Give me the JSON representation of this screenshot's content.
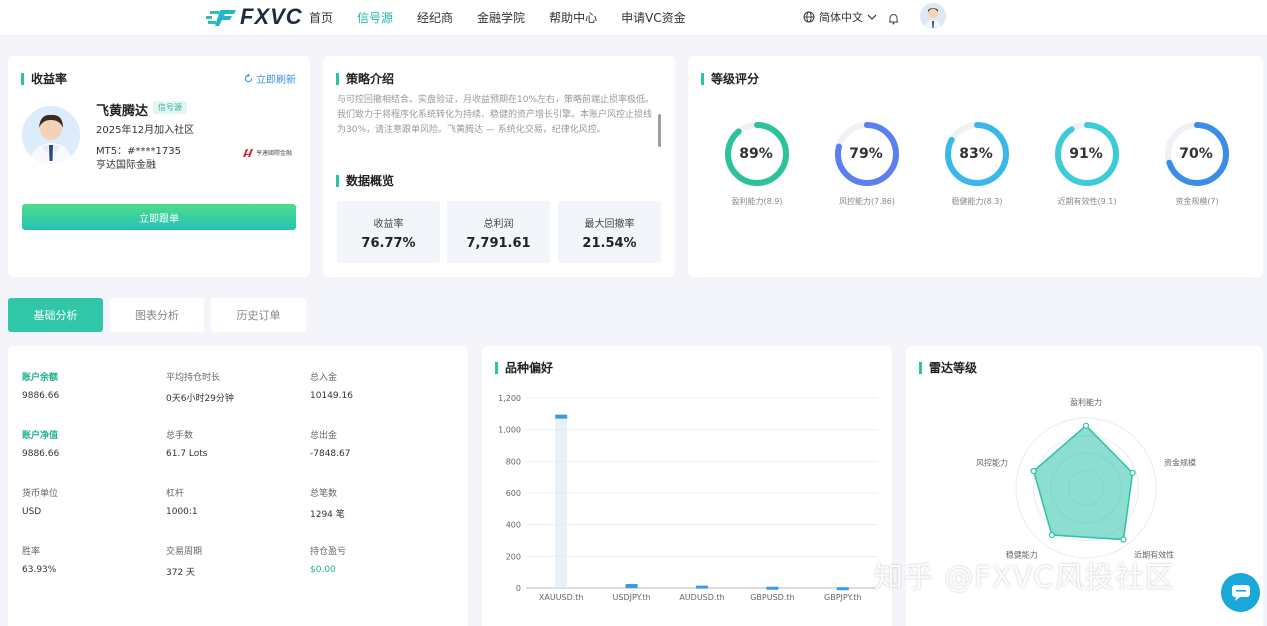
{
  "header": {
    "logo": "FXVC",
    "nav": [
      "首页",
      "信号源",
      "经纪商",
      "金融学院",
      "帮助中心",
      "申请VC资金"
    ],
    "active_index": 1,
    "language": "简体中文",
    "accent": "#1fb8a6"
  },
  "profile": {
    "title": "收益率",
    "refresh": "立即刷新",
    "name": "飞黄腾达",
    "badge": "信号源",
    "joined": "2025年12月加入社区",
    "mt5": "MT5：#****1735",
    "broker": "亨达国际金融",
    "broker_logo_text": "亨達國際金融",
    "follow": "立即跟单"
  },
  "strategy": {
    "title": "策略介绍",
    "text": "与可控回撤相结合。实盘验证，月收益预期在10%左右，策略前端止损率极低。我们致力于将程序化系统转化为持续、稳健的资产增长引擎。本账户风控止损线为30%，请注意跟单风险。飞黄腾达 — 系统化交易，纪律化风控。",
    "overview_title": "数据概览",
    "stats": [
      {
        "label": "收益率",
        "value": "76.77%"
      },
      {
        "label": "总利润",
        "value": "7,791.61"
      },
      {
        "label": "最大回撤率",
        "value": "21.54%"
      }
    ]
  },
  "rating": {
    "title": "等级评分",
    "gauges": [
      {
        "pct": "89%",
        "value": 0.89,
        "label": "盈利能力(8.9)",
        "color": "#2cc39b"
      },
      {
        "pct": "79%",
        "value": 0.79,
        "label": "风控能力(7.86)",
        "color": "#5b7ef0"
      },
      {
        "pct": "83%",
        "value": 0.83,
        "label": "稳健能力(8.3)",
        "color": "#3ab8e9"
      },
      {
        "pct": "91%",
        "value": 0.91,
        "label": "近期有效性(9.1)",
        "color": "#3dcbd8"
      },
      {
        "pct": "70%",
        "value": 0.7,
        "label": "资金规模(7)",
        "color": "#3b8ee6"
      }
    ]
  },
  "tabs": [
    "基础分析",
    "图表分析",
    "历史订单"
  ],
  "account": [
    {
      "label": "账户余额",
      "value": "9886.66",
      "highlight": true
    },
    {
      "label": "平均持仓时长",
      "value": "0天6小时29分钟"
    },
    {
      "label": "总入金",
      "value": "10149.16"
    },
    {
      "label": "账户净值",
      "value": "9886.66",
      "highlight": true
    },
    {
      "label": "总手数",
      "value": "61.7 Lots"
    },
    {
      "label": "总出金",
      "value": "-7848.67"
    },
    {
      "label": "货币单位",
      "value": "USD"
    },
    {
      "label": "杠杆",
      "value": "1000:1"
    },
    {
      "label": "总笔数",
      "value": "1294 笔"
    },
    {
      "label": "胜率",
      "value": "63.93%"
    },
    {
      "label": "交易周期",
      "value": "372 天"
    },
    {
      "label": "持仓盈亏",
      "value": "$0.00",
      "value_green": true
    }
  ],
  "variety": {
    "title": "品种偏好",
    "chart_data": {
      "type": "bar",
      "categories": [
        "XAUUSD.th",
        "USDJPY.th",
        "AUDUSD.th",
        "GBPUSD.th",
        "GBPJPY.th"
      ],
      "values": [
        1095,
        25,
        15,
        8,
        5
      ],
      "ylim": [
        0,
        1200
      ],
      "yticks": [
        0,
        200,
        400,
        600,
        800,
        1000,
        1200
      ],
      "ytick_labels": [
        "0",
        "200",
        "400",
        "600",
        "800",
        "1,000",
        "1,200"
      ],
      "color": "#3b9ae8"
    }
  },
  "radar": {
    "title": "雷达等级",
    "axes": [
      "盈利能力",
      "资金规模",
      "近期有效性",
      "稳健能力",
      "风控能力"
    ],
    "values": [
      8.9,
      7.0,
      9.1,
      8.3,
      7.86
    ],
    "max": 10,
    "color": "#2cc3a9"
  },
  "watermark": "知乎 @FXVC风投社区"
}
